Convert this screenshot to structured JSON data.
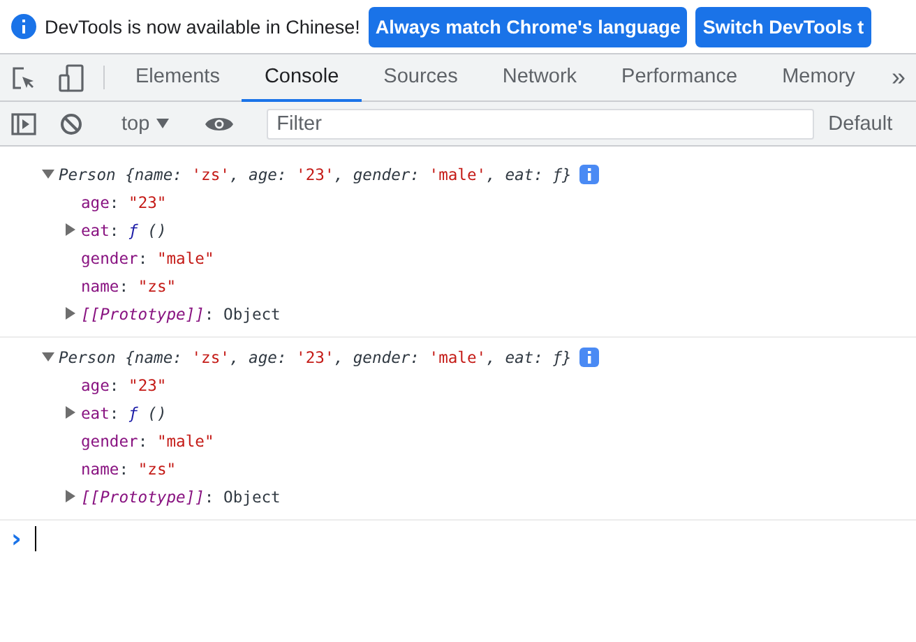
{
  "banner": {
    "message": "DevTools is now available in Chinese!",
    "buttons": [
      "Always match Chrome's language",
      "Switch DevTools t"
    ]
  },
  "tabs": [
    {
      "label": "Elements",
      "selected": false
    },
    {
      "label": "Console",
      "selected": true
    },
    {
      "label": "Sources",
      "selected": false
    },
    {
      "label": "Network",
      "selected": false
    },
    {
      "label": "Performance",
      "selected": false
    },
    {
      "label": "Memory",
      "selected": false
    }
  ],
  "more_tabs": "»",
  "toolbar": {
    "context": "top",
    "filter": {
      "placeholder": "Filter"
    },
    "levels": "Default"
  },
  "entries": [
    {
      "expanded": true,
      "summary": [
        {
          "text": "Person {name: ",
          "kind": "plain"
        },
        {
          "text": "'zs'",
          "kind": "string"
        },
        {
          "text": ", age: ",
          "kind": "plain"
        },
        {
          "text": "'23'",
          "kind": "string"
        },
        {
          "text": ", gender: ",
          "kind": "plain"
        },
        {
          "text": "'male'",
          "kind": "string"
        },
        {
          "text": ", eat: ƒ}",
          "kind": "plain"
        }
      ],
      "properties": [
        {
          "key": "age",
          "separator": ":",
          "value": "\"23\"",
          "kind": "string"
        },
        {
          "key": "eat",
          "separator": ":",
          "value": "ƒ",
          "suffix": "()",
          "kind": "function",
          "expanded": false
        },
        {
          "key": "gender",
          "separator": ":",
          "value": "\"male\"",
          "kind": "string"
        },
        {
          "key": "name",
          "separator": ":",
          "value": "\"zs\"",
          "kind": "string"
        },
        {
          "key": "[[Prototype]]",
          "separator": ":",
          "value": "Object",
          "kind": "internal",
          "expanded": false
        }
      ]
    },
    {
      "expanded": true,
      "summary": [
        {
          "text": "Person {name: ",
          "kind": "plain"
        },
        {
          "text": "'zs'",
          "kind": "string"
        },
        {
          "text": ", age: ",
          "kind": "plain"
        },
        {
          "text": "'23'",
          "kind": "string"
        },
        {
          "text": ", gender: ",
          "kind": "plain"
        },
        {
          "text": "'male'",
          "kind": "string"
        },
        {
          "text": ", eat: ƒ}",
          "kind": "plain"
        }
      ],
      "properties": [
        {
          "key": "age",
          "separator": ":",
          "value": "\"23\"",
          "kind": "string"
        },
        {
          "key": "eat",
          "separator": ":",
          "value": "ƒ",
          "suffix": "()",
          "kind": "function",
          "expanded": false
        },
        {
          "key": "gender",
          "separator": ":",
          "value": "\"male\"",
          "kind": "string"
        },
        {
          "key": "name",
          "separator": ":",
          "value": "\"zs\"",
          "kind": "string"
        },
        {
          "key": "[[Prototype]]",
          "separator": ":",
          "value": "Object",
          "kind": "internal",
          "expanded": false
        }
      ]
    }
  ],
  "prompt": {
    "symbol": "›"
  }
}
